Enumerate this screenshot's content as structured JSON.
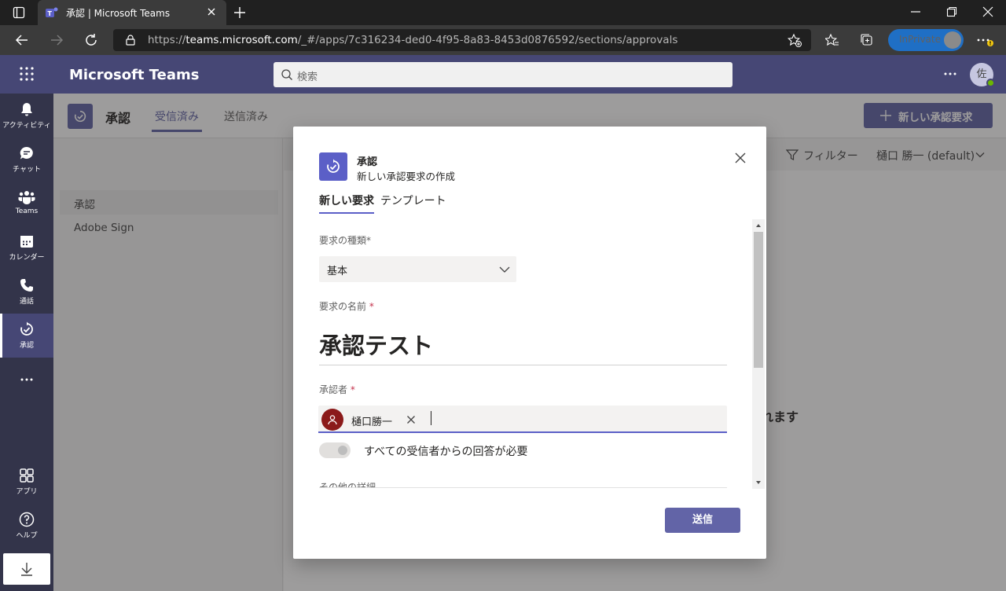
{
  "browser": {
    "tab_title": "承認 | Microsoft Teams",
    "url_prefix": "https://",
    "url_host": "teams.microsoft.com",
    "url_path": "/_#/apps/7c316234-ded0-4f95-8a83-8453d0876592/sections/approvals",
    "inprivate_label": "InPrivate"
  },
  "teams": {
    "brand": "Microsoft Teams",
    "search_placeholder": "検索",
    "user_initial": "佐"
  },
  "rail": [
    {
      "label": "アクティビティ",
      "icon": "bell-icon"
    },
    {
      "label": "チャット",
      "icon": "chat-icon"
    },
    {
      "label": "Teams",
      "icon": "teams-icon"
    },
    {
      "label": "カレンダー",
      "icon": "calendar-icon"
    },
    {
      "label": "通話",
      "icon": "phone-icon"
    },
    {
      "label": "承認",
      "icon": "approvals-icon",
      "active": true
    },
    {
      "label": "アプリ",
      "icon": "apps-icon"
    },
    {
      "label": "ヘルプ",
      "icon": "help-icon"
    }
  ],
  "app": {
    "title": "承認",
    "tabs": [
      "受信済み",
      "送信済み"
    ],
    "new_request_button": "新しい承認要求",
    "filter_label": "フィルター",
    "env_label": "樋口 勝一 (default)",
    "nav_items": [
      "承認",
      "Adobe Sign"
    ],
    "background_text": "れます"
  },
  "dialog": {
    "title": "承認",
    "subtitle": "新しい承認要求の作成",
    "tabs": [
      "新しい要求",
      "テンプレート"
    ],
    "type_label": "要求の種類",
    "type_required_mark": "*",
    "type_value": "基本",
    "name_label": "要求の名前",
    "name_required_mark": "*",
    "name_value": "承認テスト",
    "approver_label": "承認者",
    "approver_required_mark": "*",
    "approver_name": "樋口勝一",
    "toggle_label": "すべての受信者からの回答が必要",
    "details_label": "その他の詳細",
    "submit_label": "送信"
  }
}
